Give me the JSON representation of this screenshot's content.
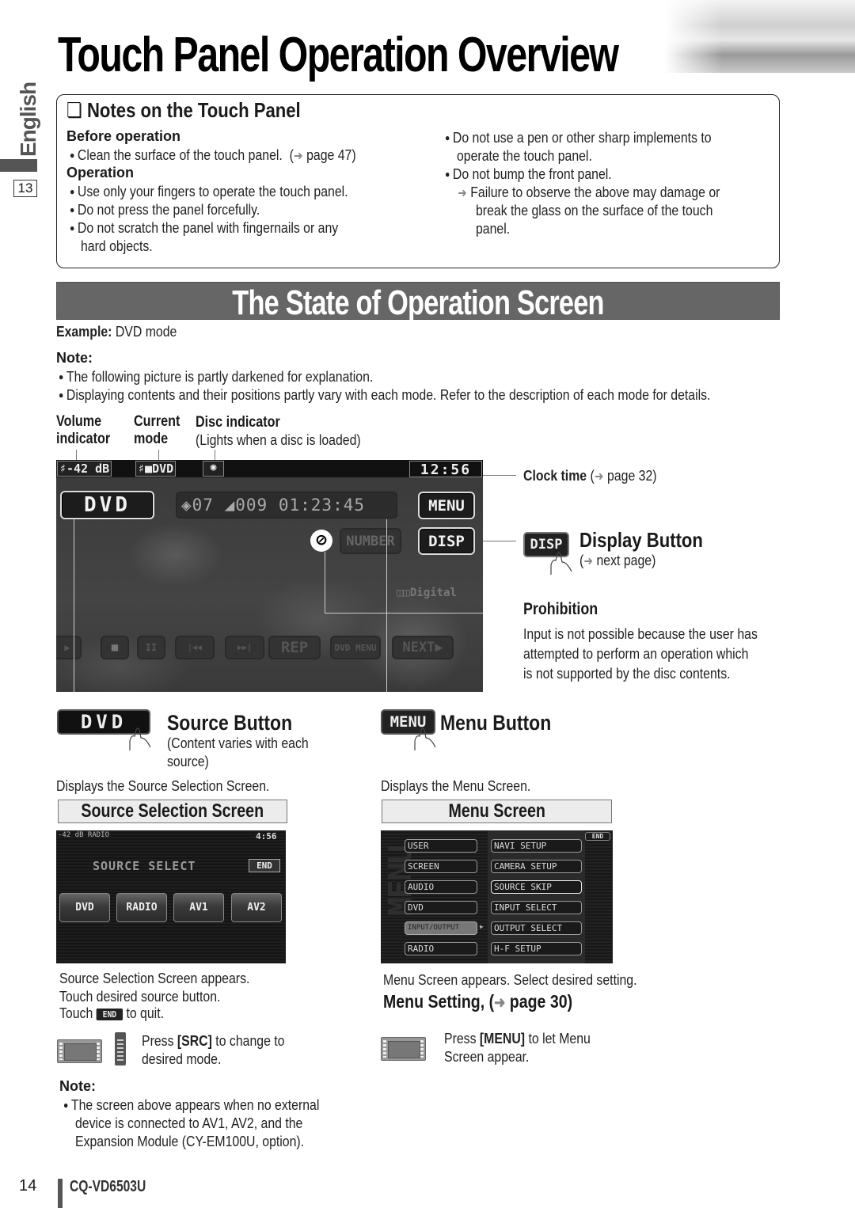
{
  "header": {
    "title": "Touch Panel Operation Overview",
    "side_language": "English",
    "side_page_index": "13"
  },
  "notes_panel": {
    "title": "Notes on the Touch Panel",
    "before_operation": {
      "heading": "Before operation",
      "items": [
        {
          "text": "Clean the surface of the touch panel.",
          "ref": "page 47"
        }
      ]
    },
    "operation": {
      "heading": "Operation",
      "items": [
        "Use only your fingers to operate the touch panel.",
        "Do not press the panel forcefully.",
        "Do not scratch the panel with fingernails or any",
        "hard objects."
      ]
    },
    "right_items": [
      "Do not use a pen or other sharp implements to",
      "operate the touch panel.",
      "Do not bump the front panel."
    ],
    "warning": [
      "Failure to observe the above may damage or",
      "break the glass on the surface of the touch",
      "panel."
    ]
  },
  "section": {
    "title": "The State of Operation Screen",
    "example_label": "Example:",
    "example_value": "DVD mode",
    "note_label": "Note:",
    "notes": [
      "The following picture is partly darkened for explanation.",
      "Displaying contents and their positions partly vary with each mode. Refer to the description of each mode for details."
    ]
  },
  "callouts": {
    "volume": [
      "Volume",
      "indicator"
    ],
    "current_mode": [
      "Current",
      "mode"
    ],
    "disc_title": "Disc indicator",
    "disc_sub": "(Lights when a disc is loaded)",
    "clock_title": "Clock time",
    "clock_ref": "page 32)",
    "clock_paren": "(",
    "display_title": "Display Button",
    "display_ref": "next page)",
    "display_paren": "(",
    "prohibition_title": "Prohibition",
    "prohibition_text": [
      "Input is not possible because the user has",
      "attempted to perform an operation which",
      "is not supported by the disc contents."
    ]
  },
  "dvd_screen": {
    "volume": "-42 dB",
    "mode": "DVD",
    "clock": "12:56",
    "source_button": "DVD",
    "chapter": "07",
    "title_num": "009",
    "elapsed": "01:23:45",
    "menu_button": "MENU",
    "number_button": "NUMBER",
    "disp_button": "DISP",
    "digital_label": "Digital",
    "transport": [
      "▶",
      "■",
      "II",
      "|◀◀",
      "▶▶|",
      "REP",
      "DVD MENU",
      "NEXT▶"
    ]
  },
  "source_button_section": {
    "button_label": "DVD",
    "title": "Source Button",
    "subtitle": [
      "(Content varies with each",
      "source)"
    ],
    "description": "Displays the Source Selection Screen.",
    "box_title": "Source Selection Screen",
    "screen": {
      "status": "-42 dB RADIO",
      "clock": "4:56",
      "heading": "SOURCE SELECT",
      "end": "END",
      "sources": [
        "DVD",
        "RADIO",
        "AV1",
        "AV2"
      ]
    },
    "instructions": [
      "Source Selection Screen appears.",
      "Touch desired source button."
    ],
    "touch_prefix": "Touch",
    "touch_end_label": "END",
    "touch_suffix": "to quit.",
    "press_prefix": "Press ",
    "press_key": "[SRC]",
    "press_suffix": " to change to",
    "press_line2": "desired mode.",
    "note_label": "Note:",
    "note_lines": [
      "The screen above appears when no external",
      "device is connected to AV1, AV2, and the",
      "Expansion Module (CY-EM100U, option)."
    ]
  },
  "menu_button_section": {
    "button_label": "MENU",
    "title": "Menu Button",
    "description": "Displays the Menu Screen.",
    "box_title": "Menu Screen",
    "screen": {
      "end": "END",
      "left_items": [
        "USER",
        "SCREEN",
        "AUDIO",
        "DVD",
        "INPUT/OUTPUT",
        "RADIO"
      ],
      "right_items": [
        "NAVI SETUP",
        "CAMERA SETUP",
        "SOURCE SKIP",
        "INPUT SELECT",
        "OUTPUT SELECT",
        "H-F SETUP"
      ],
      "selected_left": "INPUT/OUTPUT"
    },
    "instruction": "Menu Screen appears. Select desired setting.",
    "setting_ref_prefix": "Menu Setting, (",
    "setting_ref": "page 30)",
    "press_prefix": "Press ",
    "press_key": "[MENU]",
    "press_suffix": " to let Menu",
    "press_line2": "Screen appear."
  },
  "footer": {
    "page_number": "14",
    "model": "CQ-VD6503U"
  }
}
